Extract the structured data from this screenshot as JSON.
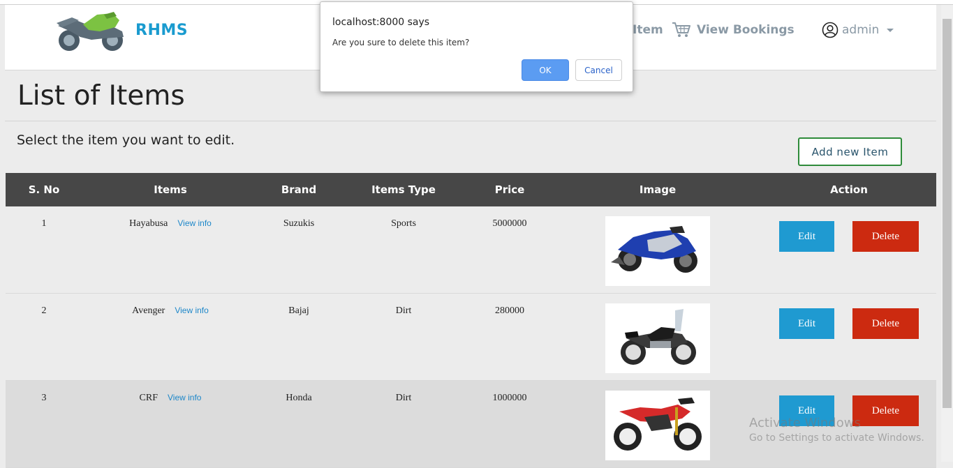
{
  "navbar": {
    "brand": "RHMS",
    "partial_nav_item": "Item",
    "view_bookings": "View Bookings",
    "user": "admin"
  },
  "page": {
    "title": "List of Items",
    "subtitle": "Select the item you want to edit.",
    "add_button": "Add new Item"
  },
  "table": {
    "headers": [
      "S. No",
      "Items",
      "Brand",
      "Items Type",
      "Price",
      "Image",
      "Action"
    ],
    "rows": [
      {
        "sno": "1",
        "item": "Hayabusa",
        "link": "View info",
        "brand": "Suzukis",
        "type": "Sports",
        "price": "5000000",
        "edit": "Edit",
        "delete": "Delete"
      },
      {
        "sno": "2",
        "item": "Avenger",
        "link": "View info",
        "brand": "Bajaj",
        "type": "Dirt",
        "price": "280000",
        "edit": "Edit",
        "delete": "Delete"
      },
      {
        "sno": "3",
        "item": "CRF",
        "link": "View info",
        "brand": "Honda",
        "type": "Dirt",
        "price": "1000000",
        "edit": "Edit",
        "delete": "Delete"
      }
    ]
  },
  "dialog": {
    "title": "localhost:8000 says",
    "message": "Are you sure to delete this item?",
    "ok": "OK",
    "cancel": "Cancel"
  },
  "watermark": {
    "line1": "Activate Windows",
    "line2": "Go to Settings to activate Windows."
  },
  "colors": {
    "brand": "#1a9bcf",
    "header_bg": "#474747",
    "edit_button": "#1f9ad1",
    "delete_button": "#cc2a10",
    "add_button_border": "#2e8b3a",
    "ok_button": "#5b9cf2"
  }
}
